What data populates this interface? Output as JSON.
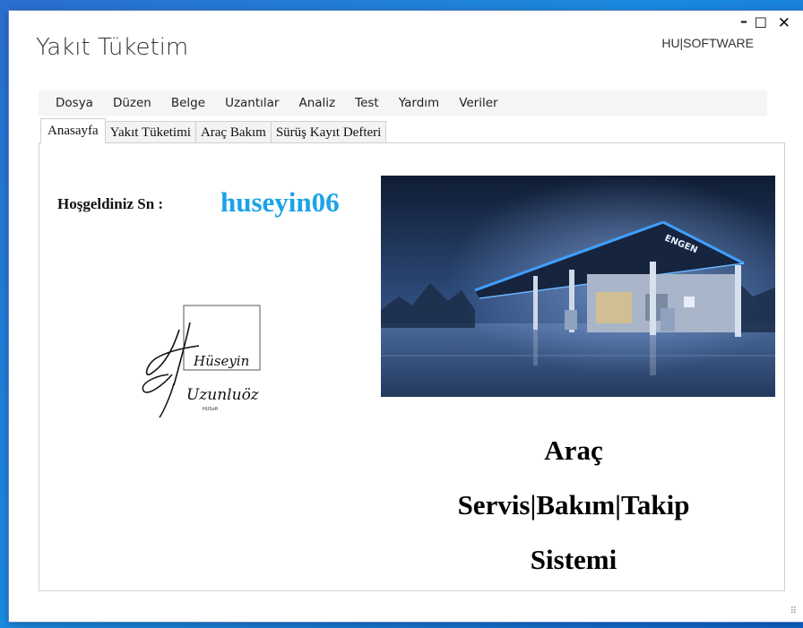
{
  "window": {
    "title": "Yakıt Tüketim",
    "brand": "HU|SOFTWARE",
    "controls": {
      "minimize": "–",
      "maximize": "☐",
      "close": "✕"
    }
  },
  "menu": {
    "items": [
      "Dosya",
      "Düzen",
      "Belge",
      "Uzantılar",
      "Analiz",
      "Test",
      "Yardım",
      "Veriler"
    ]
  },
  "tabs": [
    {
      "label": "Anasayfa",
      "active": true
    },
    {
      "label": "Yakıt Tüketimi",
      "active": false
    },
    {
      "label": "Araç Bakım",
      "active": false
    },
    {
      "label": "Sürüş Kayıt Defteri",
      "active": false
    }
  ],
  "home": {
    "welcome_label": "Hoşgeldiniz Sn :",
    "username": "huseyin06",
    "signature": {
      "line1": "Hüseyin",
      "line2": "Uzunluöz",
      "small": "HUSoft"
    },
    "photo_sign": "ENGEN",
    "headline": [
      "Araç",
      "Servis|Bakım|Takip",
      "Sistemi"
    ]
  },
  "colors": {
    "username": "#1aa3e8",
    "menubar_bg": "#f5f5f5",
    "desktop": "#1b8be0"
  }
}
